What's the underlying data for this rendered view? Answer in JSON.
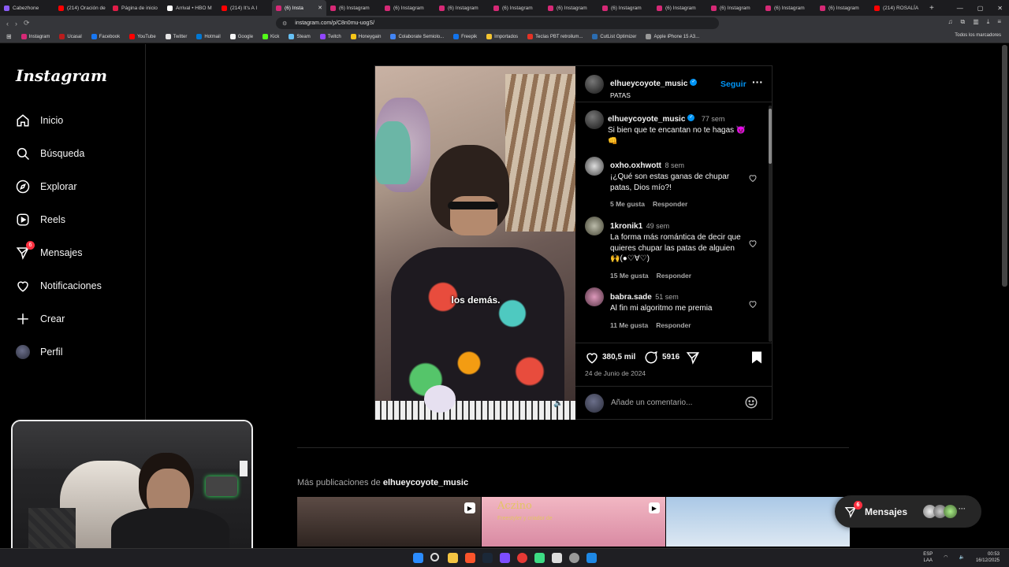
{
  "browser": {
    "tabs": [
      {
        "label": "Cabezhone",
        "color": "#8b5cf6"
      },
      {
        "label": "(214) Oración de",
        "color": "#ff0000"
      },
      {
        "label": "Página de inicio",
        "color": "#e11d48"
      },
      {
        "label": "Arrival • HBO M",
        "color": "#ffffff"
      },
      {
        "label": "(214) It's A I",
        "color": "#ff0000"
      },
      {
        "label": "(6) Insta",
        "color": "#d62976",
        "active": true
      },
      {
        "label": "(6) Instagram",
        "color": "#d62976"
      },
      {
        "label": "(6) Instagram",
        "color": "#d62976"
      },
      {
        "label": "(6) Instagram",
        "color": "#d62976"
      },
      {
        "label": "(6) Instagram",
        "color": "#d62976"
      },
      {
        "label": "(6) Instagram",
        "color": "#d62976"
      },
      {
        "label": "(6) Instagram",
        "color": "#d62976"
      },
      {
        "label": "(6) Instagram",
        "color": "#d62976"
      },
      {
        "label": "(6) Instagram",
        "color": "#d62976"
      },
      {
        "label": "(6) Instagram",
        "color": "#d62976"
      },
      {
        "label": "(6) Instagram",
        "color": "#d62976"
      },
      {
        "label": "(214) ROSALÍA",
        "color": "#ff0000"
      }
    ],
    "url": "instagram.com/p/C8n0mu-uogS/",
    "bookmarks": [
      {
        "label": "Instagram",
        "color": "#d62976"
      },
      {
        "label": "Ucasal",
        "color": "#b91c1c"
      },
      {
        "label": "Facebook",
        "color": "#1877f2"
      },
      {
        "label": "YouTube",
        "color": "#ff0000"
      },
      {
        "label": "Twitter",
        "color": "#e5e5e5"
      },
      {
        "label": "Hotmail",
        "color": "#0078d4"
      },
      {
        "label": "Google",
        "color": "#f5f5f5"
      },
      {
        "label": "Kick",
        "color": "#53fc18"
      },
      {
        "label": "Steam",
        "color": "#66c0f4"
      },
      {
        "label": "Twitch",
        "color": "#9146ff"
      },
      {
        "label": "Honeygain",
        "color": "#f5c518"
      },
      {
        "label": "Colaborate Semiolo...",
        "color": "#4285f4"
      },
      {
        "label": "Freepik",
        "color": "#1273eb"
      },
      {
        "label": "Importados",
        "color": "#f4c430"
      },
      {
        "label": "Teclas PBT retroilum...",
        "color": "#e43225"
      },
      {
        "label": "CutList Optimizer",
        "color": "#2b6cb0"
      },
      {
        "label": "Apple iPhone 15 A3...",
        "color": "#999999"
      }
    ],
    "all_bookmarks": "Todos los marcadores"
  },
  "sidebar": {
    "logo": "Instagram",
    "items": [
      {
        "label": "Inicio",
        "icon": "home-icon"
      },
      {
        "label": "Búsqueda",
        "icon": "search-icon"
      },
      {
        "label": "Explorar",
        "icon": "compass-icon"
      },
      {
        "label": "Reels",
        "icon": "reels-icon"
      },
      {
        "label": "Mensajes",
        "icon": "messenger-icon",
        "badge": "6"
      },
      {
        "label": "Notificaciones",
        "icon": "heart-icon"
      },
      {
        "label": "Crear",
        "icon": "plus-icon"
      },
      {
        "label": "Perfil",
        "icon": "avatar-icon"
      }
    ]
  },
  "post": {
    "author": "elhueycoyote_music",
    "audio": "PATAS",
    "follow": "Seguir",
    "video_caption": "los demás.",
    "caption": {
      "user": "elhueycoyote_music",
      "time": "77 sem",
      "text": "Si bien que te encantan no te hagas 😈 👊"
    },
    "comments": [
      {
        "user": "oxho.oxhwott",
        "time": "8 sem",
        "text": "¡¿Qué son estas ganas de chupar patas, Dios mío?!",
        "likes": "5 Me gusta",
        "reply": "Responder"
      },
      {
        "user": "1kronik1",
        "time": "49 sem",
        "text": "La forma más romántica de decir que quieres chupar las patas de alguien 🙌(●♡∀♡)",
        "likes": "15 Me gusta",
        "reply": "Responder"
      },
      {
        "user": "babra.sade",
        "time": "51 sem",
        "text": "Al fin mi algoritmo me premia",
        "likes": "11 Me gusta",
        "reply": "Responder"
      }
    ],
    "likes": "380,5 mil",
    "comment_count": "5916",
    "date": "24 de Junio de 2024",
    "comment_placeholder": "Añade un comentario..."
  },
  "more_posts": {
    "prefix": "Más publicaciones de",
    "user": "elhueycoyote_music",
    "thumb_text_title": "Aczino",
    "thumb_text_sub": "Freestyler y criador de"
  },
  "messages_pill": {
    "label": "Mensajes",
    "badge": "6"
  },
  "taskbar": {
    "lang1": "ESP",
    "lang2": "LAA",
    "time": "00:53",
    "date": "16/12/2025"
  }
}
